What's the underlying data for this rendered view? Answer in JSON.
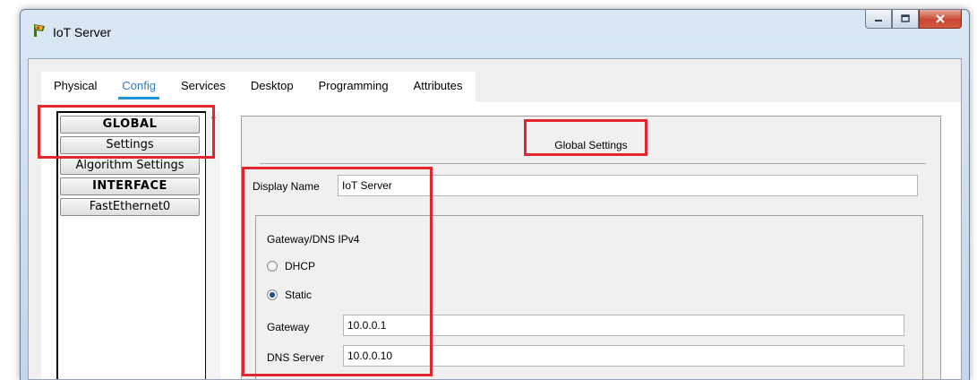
{
  "window": {
    "title": "IoT Server",
    "app_icon": "packet-tracer-icon",
    "controls": [
      "minimize-icon",
      "maximize-icon",
      "close-icon"
    ]
  },
  "tabs": [
    {
      "label": "Physical",
      "active": false
    },
    {
      "label": "Config",
      "active": true
    },
    {
      "label": "Services",
      "active": false
    },
    {
      "label": "Desktop",
      "active": false
    },
    {
      "label": "Programming",
      "active": false
    },
    {
      "label": "Attributes",
      "active": false
    }
  ],
  "sidebar": {
    "items": [
      {
        "label": "GLOBAL",
        "header": true
      },
      {
        "label": "Settings",
        "header": false
      },
      {
        "label": "Algorithm Settings",
        "header": false
      },
      {
        "label": "INTERFACE",
        "header": true
      },
      {
        "label": "FastEthernet0",
        "header": false
      }
    ]
  },
  "panel": {
    "title": "Global Settings",
    "display_name_label": "Display Name",
    "display_name_value": "IoT Server",
    "gateway_group_label": "Gateway/DNS IPv4",
    "dhcp_label": "DHCP",
    "static_label": "Static",
    "selected_mode": "Static",
    "gateway_label": "Gateway",
    "gateway_value": "10.0.0.1",
    "dns_label": "DNS Server",
    "dns_value": "10.0.0.10"
  },
  "colors": {
    "highlight": "#e1262e",
    "active_tab": "#2f7cc7",
    "tab_underline": "#1f98d6"
  }
}
